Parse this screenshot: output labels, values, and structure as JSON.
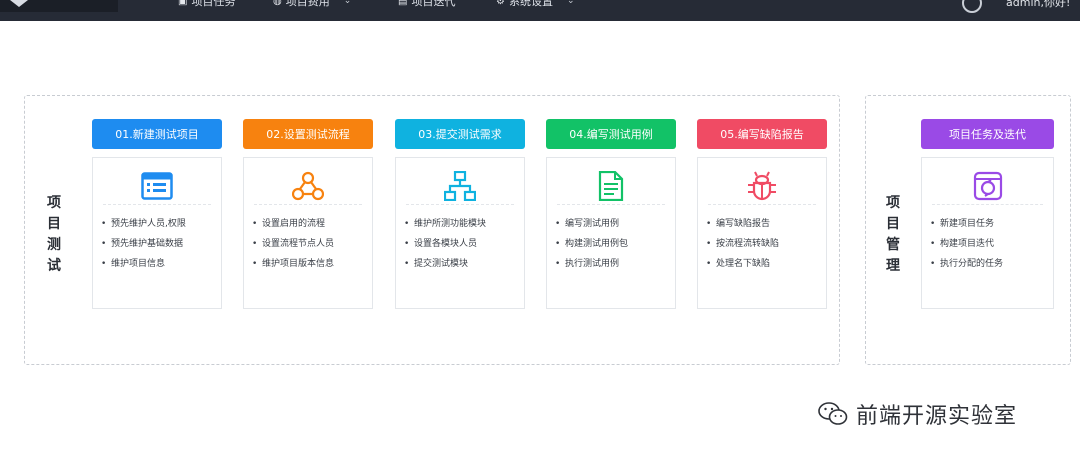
{
  "topnav": {
    "items": [
      {
        "label": "项目任务",
        "icon": "task-icon"
      },
      {
        "label": "项目费用",
        "icon": "globe-icon"
      },
      {
        "label": "项目迭代",
        "icon": "document-icon"
      },
      {
        "label": "系统设置",
        "icon": "gear-icon"
      }
    ],
    "user": "admin,你好!"
  },
  "sections": {
    "test_label": "项目测试",
    "mgmt_label": "项目管理"
  },
  "steps": [
    {
      "title": "01.新建测试项目",
      "color": "#1e8cf0",
      "icon": "list-icon",
      "items": [
        "预先维护人员,权限",
        "预先维护基础数据",
        "维护项目信息"
      ]
    },
    {
      "title": "02.设置测试流程",
      "color": "#f7820f",
      "icon": "flow-icon",
      "items": [
        "设置启用的流程",
        "设置流程节点人员",
        "维护项目版本信息"
      ]
    },
    {
      "title": "03.提交测试需求",
      "color": "#0fb2e0",
      "icon": "hierarchy-icon",
      "items": [
        "维护所测功能模块",
        "设置各模块人员",
        "提交测试模块"
      ]
    },
    {
      "title": "04.编写测试用例",
      "color": "#12c267",
      "icon": "document-icon",
      "items": [
        "编写测试用例",
        "构建测试用例包",
        "执行测试用例"
      ]
    },
    {
      "title": "05.编写缺陷报告",
      "color": "#f04b64",
      "icon": "bug-icon",
      "items": [
        "编写缺陷报告",
        "按流程流转缺陷",
        "处理名下缺陷"
      ]
    }
  ],
  "mgmt": {
    "title": "项目任务及迭代",
    "color": "#9a4ae6",
    "icon": "cycle-icon",
    "items": [
      "新建项目任务",
      "构建项目迭代",
      "执行分配的任务"
    ]
  },
  "watermark": {
    "text": "前端开源实验室",
    "icon": "wechat-icon"
  }
}
